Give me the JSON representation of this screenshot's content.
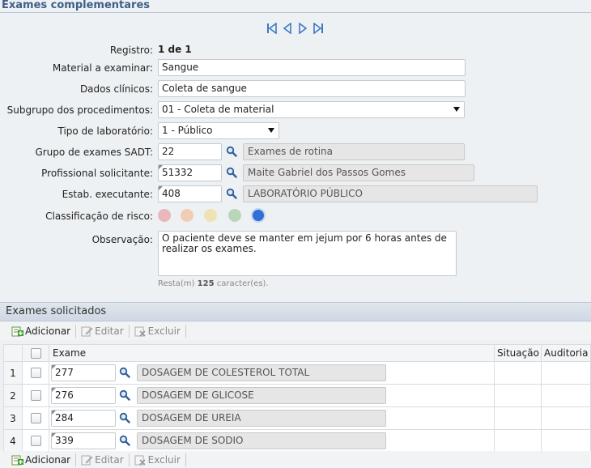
{
  "header": {
    "title": "Exames complementares"
  },
  "nav": {
    "icons": [
      "first-page-icon",
      "previous-page-icon",
      "next-page-icon",
      "last-page-icon"
    ]
  },
  "form": {
    "registro_label": "Registro:",
    "registro_value": "1 de 1",
    "material_label": "Material a examinar:",
    "material_value": "Sangue",
    "dados_label": "Dados clínicos:",
    "dados_value": "Coleta de sangue",
    "subgrupo_label": "Subgrupo dos procedimentos:",
    "subgrupo_value": "01 - Coleta de material",
    "tipo_label": "Tipo de laboratório:",
    "tipo_value": "1 - Público",
    "grupo_label": "Grupo de exames SADT:",
    "grupo_code": "22",
    "grupo_desc": "Exames de rotina",
    "prof_label": "Profissional solicitante:",
    "prof_code": "51332",
    "prof_desc": "Maite Gabriel dos Passos Gomes",
    "estab_label": "Estab. executante:",
    "estab_code": "408",
    "estab_desc": "LABORATÓRIO PÚBLICO",
    "risco_label": "Classificação de risco:",
    "risco_colors": [
      "#e9b8ba",
      "#f1cdb5",
      "#efe3b3",
      "#b9d6b9",
      "#2f6fd6"
    ],
    "obs_label": "Observação:",
    "obs_value": "O paciente deve se manter em jejum por 6 horas antes de realizar os exames.",
    "remain_prefix": "Resta(m)",
    "remain_count": "125",
    "remain_suffix": "caracter(es)."
  },
  "exams": {
    "title": "Exames solicitados",
    "toolbar": {
      "add": "Adicionar",
      "edit": "Editar",
      "delete": "Excluir"
    },
    "columns": {
      "exame": "Exame",
      "situacao": "Situação",
      "auditoria": "Auditoria"
    },
    "rows": [
      {
        "num": "1",
        "code": "277",
        "desc": "DOSAGEM DE COLESTEROL TOTAL"
      },
      {
        "num": "2",
        "code": "276",
        "desc": "DOSAGEM DE GLICOSE"
      },
      {
        "num": "3",
        "code": "284",
        "desc": "DOSAGEM DE UREIA"
      },
      {
        "num": "4",
        "code": "339",
        "desc": "DOSAGEM DE SODIO"
      }
    ]
  }
}
